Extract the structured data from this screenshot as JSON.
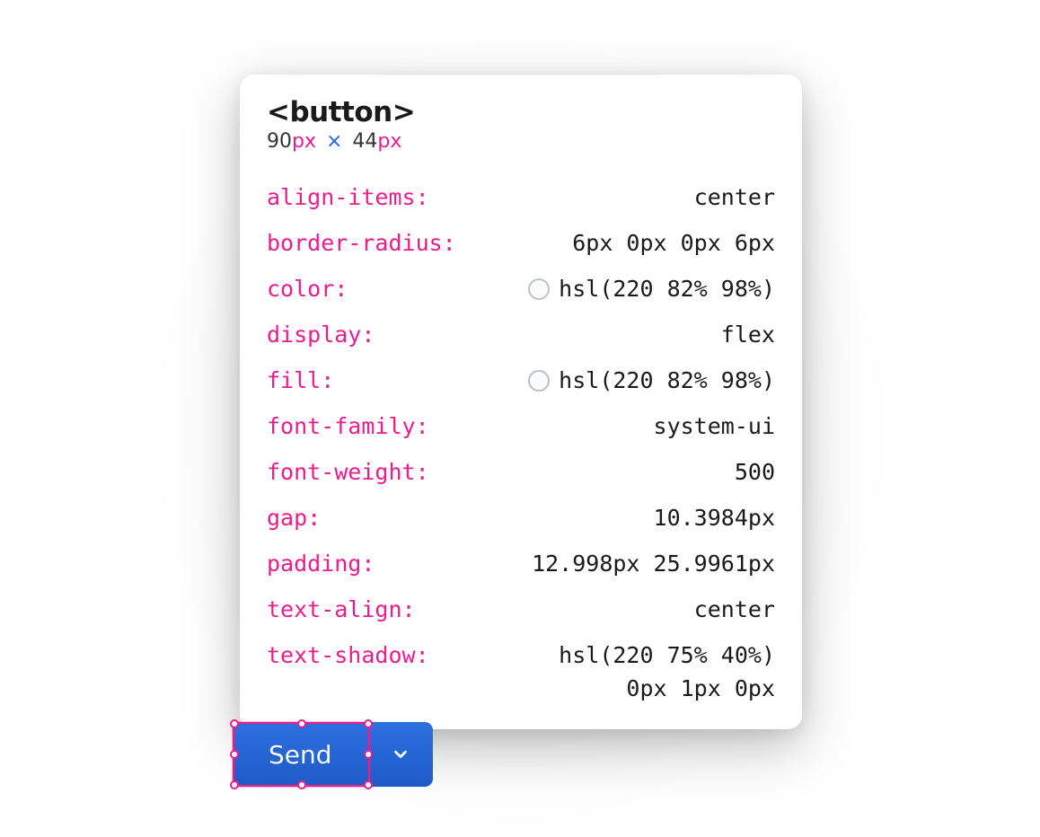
{
  "tooltip": {
    "element_tag": "<button>",
    "width_value": "90",
    "width_unit": "px",
    "times": "×",
    "height_value": "44",
    "height_unit": "px",
    "properties": [
      {
        "name": "align-items:",
        "value": "center",
        "swatch": false
      },
      {
        "name": "border-radius:",
        "value": "6px 0px 0px 6px",
        "swatch": false
      },
      {
        "name": "color:",
        "value": "hsl(220 82% 98%)",
        "swatch": true
      },
      {
        "name": "display:",
        "value": "flex",
        "swatch": false
      },
      {
        "name": "fill:",
        "value": "hsl(220 82% 98%)",
        "swatch": true
      },
      {
        "name": "font-family:",
        "value": "system-ui",
        "swatch": false
      },
      {
        "name": "font-weight:",
        "value": "500",
        "swatch": false
      },
      {
        "name": "gap:",
        "value": "10.3984px",
        "swatch": false
      },
      {
        "name": "padding:",
        "value": "12.998px 25.9961px",
        "swatch": false
      },
      {
        "name": "text-align:",
        "value": "center",
        "swatch": false
      },
      {
        "name": "text-shadow:",
        "value": "hsl(220 75% 40%)",
        "value2": "0px 1px 0px",
        "swatch": false
      }
    ]
  },
  "buttons": {
    "send_label": "Send",
    "dropdown_icon": "chevron-down-icon"
  }
}
